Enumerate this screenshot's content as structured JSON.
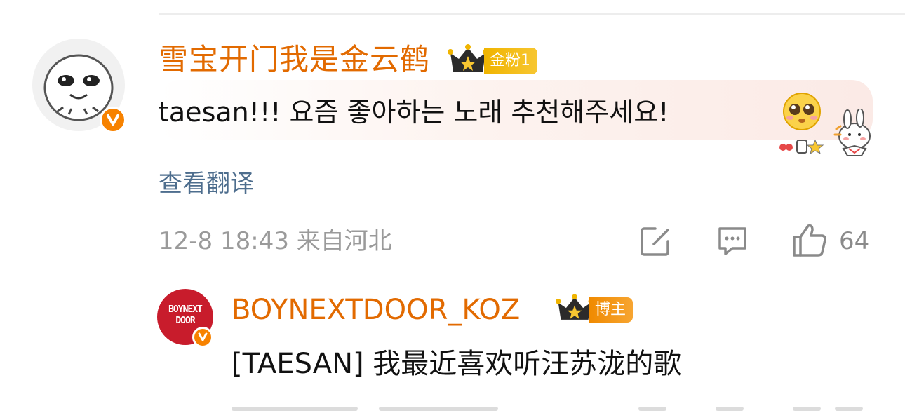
{
  "comment": {
    "username": "雪宝开门我是金云鹤",
    "badge": "金粉1",
    "text": "taesan!!!  요즘 좋아하는 노래 추천해주세요!",
    "translate_label": "查看翻译",
    "meta": "12-8 18:43 来自河北",
    "like_count": "64",
    "icons": {
      "avatar": "cartoon-face-avatar",
      "verified": "verified-badge-icon",
      "crown": "crown-icon",
      "emoji": "pleading-face-emoji",
      "deco": "bunny-sticker",
      "share": "share-edit-icon",
      "reply": "comment-icon",
      "like": "thumbs-up-icon"
    }
  },
  "reply": {
    "username": "BOYNEXTDOOR_KOZ",
    "badge": "博主",
    "text": "[TAESAN] 我最近喜欢听汪苏泷的歌",
    "avatar_logo": "BOYNEXT DOOR"
  },
  "colors": {
    "username": "#e26a00",
    "verified": "#f78200",
    "fan_badge": "#f0b400",
    "blogger_badge": "#f08a00",
    "link": "#4e6e8e",
    "meta": "#9a9a9a"
  }
}
